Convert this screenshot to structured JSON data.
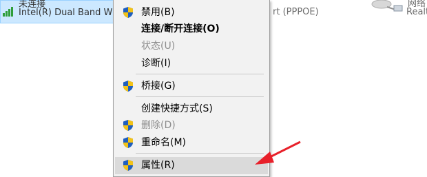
{
  "adapters": {
    "left": {
      "name_partial": "未连接",
      "device_partial": "Intel(R) Dual Band Wir"
    },
    "middle": {
      "device_partial": "rt (PPPOE)"
    },
    "right": {
      "name_partial": "网络",
      "device_partial": "Realt"
    }
  },
  "context_menu": {
    "items": [
      {
        "label": "禁用(B)",
        "icon": "shield-icon",
        "bold": false,
        "disabled": false
      },
      {
        "label": "连接/断开连接(O)",
        "icon": null,
        "bold": true,
        "disabled": false
      },
      {
        "label": "状态(U)",
        "icon": null,
        "bold": false,
        "disabled": true
      },
      {
        "label": "诊断(I)",
        "icon": null,
        "bold": false,
        "disabled": false
      },
      {
        "label": "桥接(G)",
        "icon": "shield-icon",
        "bold": false,
        "disabled": false
      },
      {
        "label": "创建快捷方式(S)",
        "icon": null,
        "bold": false,
        "disabled": false
      },
      {
        "label": "删除(D)",
        "icon": "shield-icon",
        "bold": false,
        "disabled": true
      },
      {
        "label": "重命名(M)",
        "icon": "shield-icon",
        "bold": false,
        "disabled": false
      },
      {
        "label": "属性(R)",
        "icon": "shield-icon",
        "bold": false,
        "disabled": false,
        "highlighted": true
      }
    ]
  },
  "colors": {
    "selection_bg": "#cce8ff",
    "menu_bg": "#f2f2f2",
    "highlight_bg": "#dadada",
    "arrow": "#e8202a"
  }
}
